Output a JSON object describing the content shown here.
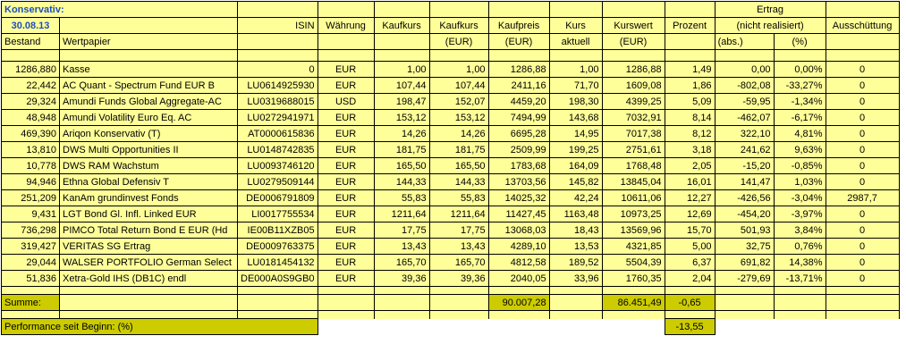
{
  "title": "Konservativ:",
  "date": "30.08.13",
  "headers": {
    "bestand": "Bestand",
    "wertpapier": "Wertpapier",
    "isin": "ISIN",
    "waehrung": "Währung",
    "kaufkurs": "Kaufkurs",
    "kaufkurs_eur_1": "Kaufkurs",
    "kaufkurs_eur_2": "(EUR)",
    "kaufpreis_1": "Kaufpreis",
    "kaufpreis_2": "(EUR)",
    "kurs_1": "Kurs",
    "kurs_2": "aktuell",
    "kurswert_1": "Kurswert",
    "kurswert_2": "(EUR)",
    "prozent": "Prozent",
    "ertrag_1": "Ertrag",
    "ertrag_2": "(nicht realisiert)",
    "ertrag_abs": "(abs.)",
    "ertrag_pct": "(%)",
    "ausschuettung": "Ausschüttung"
  },
  "rows": [
    {
      "bestand": "1286,880",
      "name": "Kasse",
      "isin": "0",
      "cur": "EUR",
      "kk": "1,00",
      "kke": "1,00",
      "kp": "1286,88",
      "kurs": "1,00",
      "kw": "1286,88",
      "pz": "1,49",
      "abs": "0,00",
      "pct": "0,00%",
      "aus": "0"
    },
    {
      "bestand": "22,442",
      "name": "AC Quant - Spectrum Fund EUR B",
      "isin": "LU0614925930",
      "cur": "EUR",
      "kk": "107,44",
      "kke": "107,44",
      "kp": "2411,16",
      "kurs": "71,70",
      "kw": "1609,08",
      "pz": "1,86",
      "abs": "-802,08",
      "pct": "-33,27%",
      "aus": "0"
    },
    {
      "bestand": "29,324",
      "name": "Amundi Funds Global Aggregate-AC",
      "isin": "LU0319688015",
      "cur": "USD",
      "kk": "198,47",
      "kke": "152,07",
      "kp": "4459,20",
      "kurs": "198,30",
      "kw": "4399,25",
      "pz": "5,09",
      "abs": "-59,95",
      "pct": "-1,34%",
      "aus": "0"
    },
    {
      "bestand": "48,948",
      "name": "Amundi Volatility Euro Eq. AC",
      "isin": "LU0272941971",
      "cur": "EUR",
      "kk": "153,12",
      "kke": "153,12",
      "kp": "7494,99",
      "kurs": "143,68",
      "kw": "7032,91",
      "pz": "8,14",
      "abs": "-462,07",
      "pct": "-6,17%",
      "aus": "0"
    },
    {
      "bestand": "469,390",
      "name": "Ariqon Konservativ (T)",
      "isin": "AT0000615836",
      "cur": "EUR",
      "kk": "14,26",
      "kke": "14,26",
      "kp": "6695,28",
      "kurs": "14,95",
      "kw": "7017,38",
      "pz": "8,12",
      "abs": "322,10",
      "pct": "4,81%",
      "aus": "0"
    },
    {
      "bestand": "13,810",
      "name": "DWS Multi Opportunities II",
      "isin": "LU0148742835",
      "cur": "EUR",
      "kk": "181,75",
      "kke": "181,75",
      "kp": "2509,99",
      "kurs": "199,25",
      "kw": "2751,61",
      "pz": "3,18",
      "abs": "241,62",
      "pct": "9,63%",
      "aus": "0"
    },
    {
      "bestand": "10,778",
      "name": "DWS RAM Wachstum",
      "isin": "LU0093746120",
      "cur": "EUR",
      "kk": "165,50",
      "kke": "165,50",
      "kp": "1783,68",
      "kurs": "164,09",
      "kw": "1768,48",
      "pz": "2,05",
      "abs": "-15,20",
      "pct": "-0,85%",
      "aus": "0"
    },
    {
      "bestand": "94,946",
      "name": "Ethna Global Defensiv T",
      "isin": "LU0279509144",
      "cur": "EUR",
      "kk": "144,33",
      "kke": "144,33",
      "kp": "13703,56",
      "kurs": "145,82",
      "kw": "13845,04",
      "pz": "16,01",
      "abs": "141,47",
      "pct": "1,03%",
      "aus": "0"
    },
    {
      "bestand": "251,209",
      "name": "KanAm grundinvest Fonds",
      "isin": "DE0006791809",
      "cur": "EUR",
      "kk": "55,83",
      "kke": "55,83",
      "kp": "14025,32",
      "kurs": "42,24",
      "kw": "10611,06",
      "pz": "12,27",
      "abs": "-426,56",
      "pct": "-3,04%",
      "aus": "2987,7"
    },
    {
      "bestand": "9,431",
      "name": "LGT Bond Gl. Infl. Linked EUR",
      "isin": "LI0017755534",
      "cur": "EUR",
      "kk": "1211,64",
      "kke": "1211,64",
      "kp": "11427,45",
      "kurs": "1163,48",
      "kw": "10973,25",
      "pz": "12,69",
      "abs": "-454,20",
      "pct": "-3,97%",
      "aus": "0"
    },
    {
      "bestand": "736,298",
      "name": "PIMCO Total Return Bond E EUR (Hd",
      "isin": "IE00B11XZB05",
      "cur": "EUR",
      "kk": "17,75",
      "kke": "17,75",
      "kp": "13068,03",
      "kurs": "18,43",
      "kw": "13569,96",
      "pz": "15,70",
      "abs": "501,93",
      "pct": "3,84%",
      "aus": "0"
    },
    {
      "bestand": "319,427",
      "name": "VERITAS SG Ertrag",
      "isin": "DE0009763375",
      "cur": "EUR",
      "kk": "13,43",
      "kke": "13,43",
      "kp": "4289,10",
      "kurs": "13,53",
      "kw": "4321,85",
      "pz": "5,00",
      "abs": "32,75",
      "pct": "0,76%",
      "aus": "0"
    },
    {
      "bestand": "29,044",
      "name": "WALSER PORTFOLIO German Select",
      "isin": "LU0181454132",
      "cur": "EUR",
      "kk": "165,70",
      "kke": "165,70",
      "kp": "4812,58",
      "kurs": "189,52",
      "kw": "5504,39",
      "pz": "6,37",
      "abs": "691,82",
      "pct": "14,38%",
      "aus": "0"
    },
    {
      "bestand": "51,836",
      "name": "Xetra-Gold IHS (DB1C) endl",
      "isin": "DE000A0S9GB0",
      "cur": "EUR",
      "kk": "39,36",
      "kke": "39,36",
      "kp": "2040,05",
      "kurs": "33,96",
      "kw": "1760,35",
      "pz": "2,04",
      "abs": "-279,69",
      "pct": "-13,71%",
      "aus": "0"
    }
  ],
  "summe": {
    "label": "Summe:",
    "kaufpreis": "90.007,28",
    "kurswert": "86.451,49",
    "prozent": "-0,65"
  },
  "performance": {
    "label": "Performance seit Beginn: (%)",
    "value": "-13,55"
  },
  "colors": {
    "header_fill": "#ffff99",
    "summary_fill": "#cccc00",
    "title_color": "#1f4fbf"
  }
}
